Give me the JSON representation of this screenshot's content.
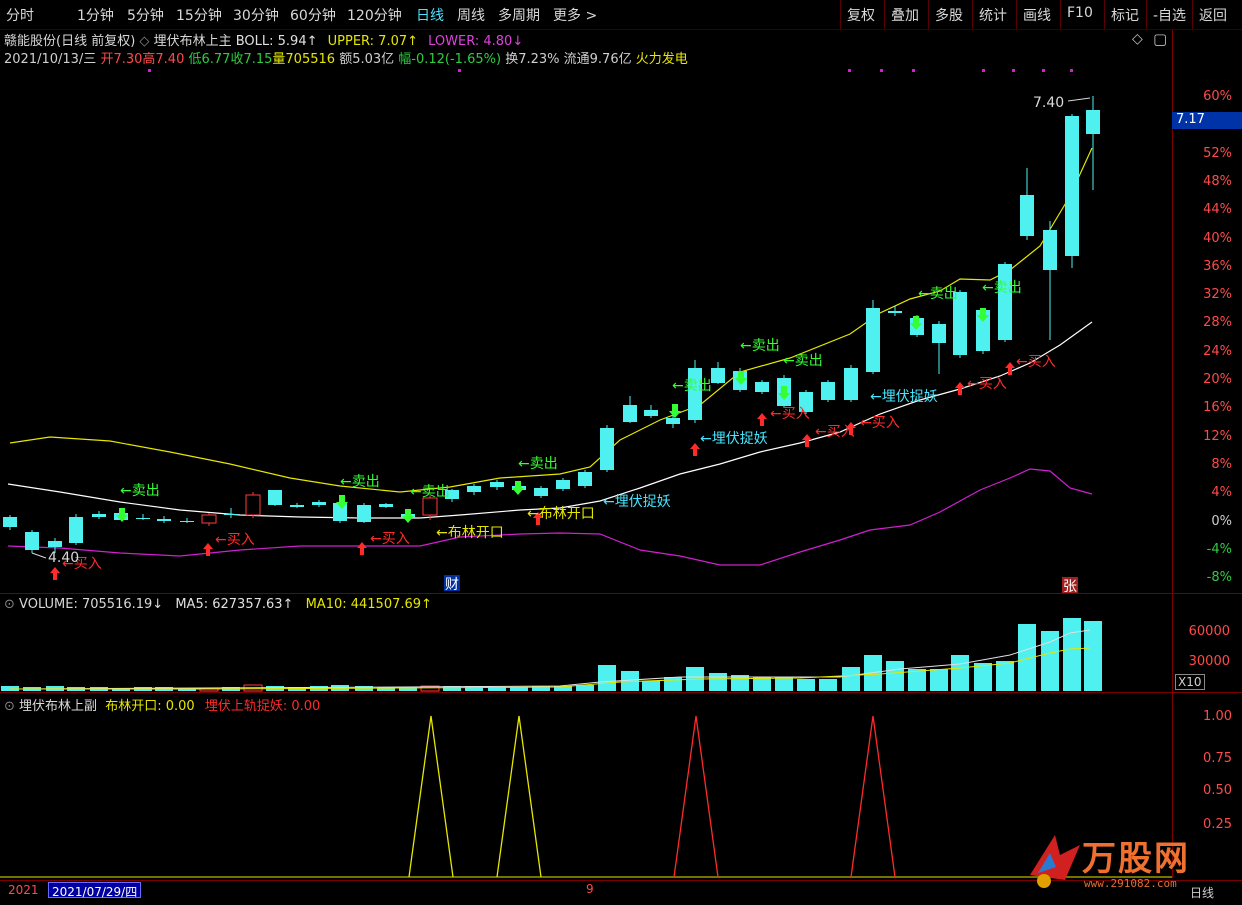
{
  "toolbar": {
    "tabs": [
      "分时",
      "1分钟",
      "5分钟",
      "15分钟",
      "30分钟",
      "60分钟",
      "120分钟",
      "日线",
      "周线",
      "多周期",
      "更多 >"
    ],
    "active_tab": "日线",
    "right_buttons": [
      "复权",
      "叠加",
      "多股",
      "统计",
      "画线",
      "F10",
      "标记",
      "-自选",
      "返回"
    ]
  },
  "header": {
    "stock": "赣能股份(日线 前复权)",
    "indicator": "埋伏布林上主",
    "boll": "BOLL: 5.94↑",
    "upper": "UPPER: 7.07↑",
    "lower": "LOWER: 4.80↓",
    "date": "2021/10/13/三",
    "open": "开7.30",
    "high": "高7.40",
    "low": "低6.77",
    "close": "收7.15",
    "volume": "量705516",
    "amount": "额5.03亿",
    "change": "幅-0.12(-1.65%)",
    "turnover": "换7.23%",
    "float": "流通9.76亿",
    "concept": "火力发电"
  },
  "price_axis": {
    "labels": [
      "60%",
      "56%",
      "52%",
      "48%",
      "44%",
      "40%",
      "36%",
      "32%",
      "28%",
      "24%",
      "20%",
      "16%",
      "12%",
      "8%",
      "4%",
      "0%",
      "-4%",
      "-8%"
    ],
    "current_price": "7.17",
    "high_marker": "7.40",
    "low_marker": "4.40"
  },
  "annotations": {
    "sell": "←卖出",
    "buy": "←买入",
    "ambush": "←埋伏捉妖",
    "boll_open": "←布林开口",
    "finance_badge": "财",
    "up_badge": "张"
  },
  "volume_panel": {
    "volume": "VOLUME: 705516.19↓",
    "ma5": "MA5: 627357.63↑",
    "ma10": "MA10: 441507.69↑",
    "axis": [
      "60000",
      "30000"
    ],
    "unit": "X10"
  },
  "sub_panel": {
    "title": "埋伏布林上副",
    "boll_open": "布林开口: 0.00",
    "ambush": "埋伏上轨捉妖: 0.00",
    "axis": [
      "1.00",
      "0.75",
      "0.50",
      "0.25"
    ]
  },
  "bottom": {
    "left_date": "2021",
    "cursor_date": "2021/07/29/四",
    "month_mark": "9",
    "right_label": "日线",
    "logo": "万股网",
    "logo_url": "www.291082.com"
  },
  "colors": {
    "up": "#ff3c3c",
    "down": "#4ef0f0",
    "upper_line": "#e6e600",
    "mid_line": "#ffffff",
    "lower_line": "#d020d0",
    "sell_text": "#33ff33",
    "buy_text": "#ff2a2a",
    "ambush_text": "#44e6ff",
    "open_text": "#e6e600"
  }
}
